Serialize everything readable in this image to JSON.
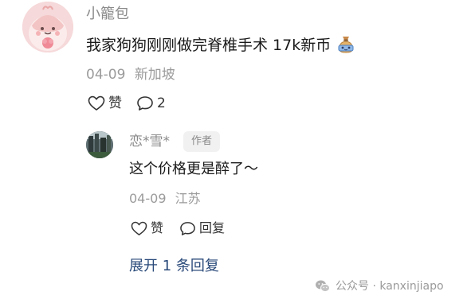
{
  "comment": {
    "username": "小籠包",
    "text": "我家狗狗刚刚做完脊椎手术 17k新币",
    "emoji_icon": "money-bag-icon",
    "date": "04-09",
    "location": "新加坡",
    "like_label": "赞",
    "reply_count": "2"
  },
  "reply": {
    "username": "恋*雪*",
    "badge": "作者",
    "text": "这个价格更是醉了～",
    "date": "04-09",
    "location": "江苏",
    "like_label": "赞",
    "reply_label": "回复"
  },
  "expand": {
    "label": "展开 1 条回复"
  },
  "watermark": {
    "text": "公众号 · kanxinjiapo"
  },
  "colors": {
    "link": "#2a4a7a",
    "muted": "#9b9b9b",
    "text": "#1a1a1a"
  }
}
